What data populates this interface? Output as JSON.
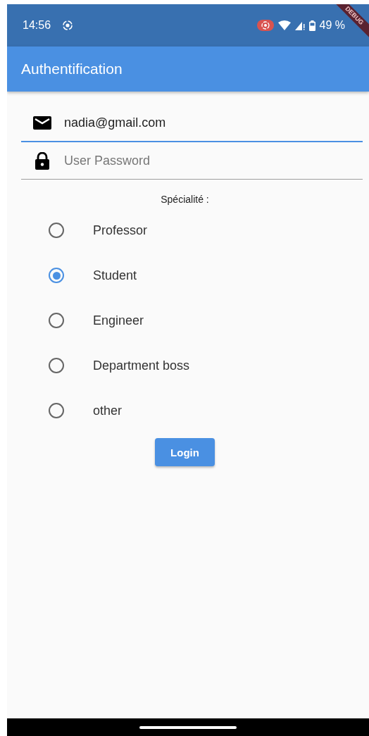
{
  "status_bar": {
    "time": "14:56",
    "battery": "49 %"
  },
  "debug_banner": "DEBUG",
  "app_bar": {
    "title": "Authentification"
  },
  "email_field": {
    "value": "nadia@gmail.com",
    "focused": true
  },
  "password_field": {
    "placeholder": "User Password",
    "focused": false
  },
  "specialty_label": "Spécialité :",
  "options": [
    {
      "label": "Professor",
      "selected": false
    },
    {
      "label": "Student",
      "selected": true
    },
    {
      "label": "Engineer",
      "selected": false
    },
    {
      "label": "Department boss",
      "selected": false
    },
    {
      "label": "other",
      "selected": false
    }
  ],
  "login_button": "Login"
}
